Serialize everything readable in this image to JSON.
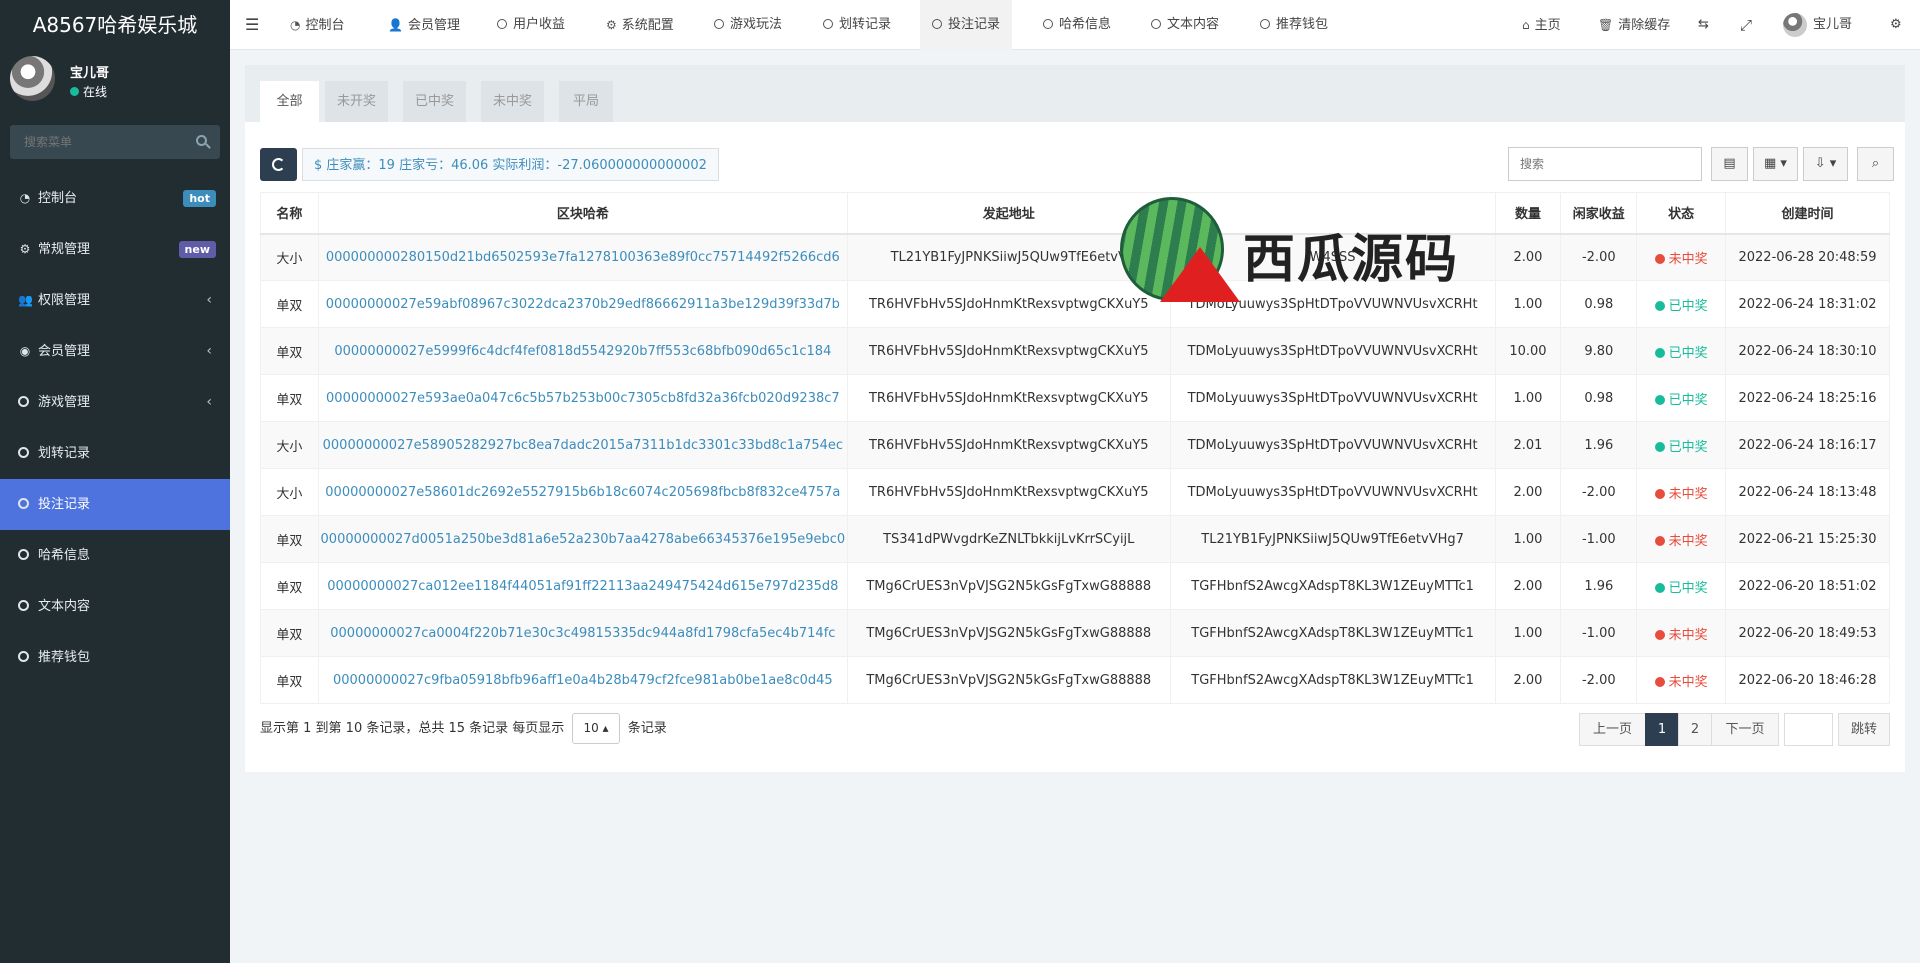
{
  "brand": "A8567哈希娱乐城",
  "user": {
    "name": "宝儿哥",
    "status": "在线"
  },
  "sidebar": {
    "search_placeholder": "搜索菜单",
    "items": [
      {
        "label": "控制台",
        "icon": "dashboard-icon",
        "badge": "hot"
      },
      {
        "label": "常规管理",
        "icon": "cogs-icon",
        "badge": "new"
      },
      {
        "label": "权限管理",
        "icon": "group-icon",
        "chevron": "‹"
      },
      {
        "label": "会员管理",
        "icon": "user-circle-icon",
        "chevron": "‹"
      },
      {
        "label": "游戏管理",
        "icon": "circle-icon",
        "chevron": "‹"
      },
      {
        "label": "划转记录",
        "icon": "circle-icon"
      },
      {
        "label": "投注记录",
        "icon": "circle-icon",
        "active": true
      },
      {
        "label": "哈希信息",
        "icon": "circle-icon"
      },
      {
        "label": "文本内容",
        "icon": "circle-icon"
      },
      {
        "label": "推荐钱包",
        "icon": "circle-icon"
      }
    ]
  },
  "topnav": {
    "tabs": [
      "控制台",
      "会员管理",
      "用户收益",
      "系统配置",
      "游戏玩法",
      "划转记录",
      "投注记录",
      "哈希信息",
      "文本内容",
      "推荐钱包"
    ],
    "home": "主页",
    "clear_cache": "清除缓存",
    "user": "宝儿哥"
  },
  "filters": [
    "全部",
    "未开奖",
    "已中奖",
    "未中奖",
    "平局"
  ],
  "summary": "$ 庄家赢：19 庄家亏：46.06 实际利润：-27.060000000000002",
  "search_placeholder": "搜索",
  "columns": [
    "名称",
    "区块哈希",
    "发起地址",
    "",
    "数量",
    "闲家收益",
    "状态",
    "创建时间"
  ],
  "rows": [
    {
      "name": "大小",
      "hash": "000000000280150d21bd6502593e7fa1278100363e89f0cc75714492f5266cd6",
      "from": "TL21YB1FyJPNKSiiwJ5QUw9TfE6etvV",
      "to": "W4SSS",
      "amount": "2.00",
      "profit": "-2.00",
      "status": "未中奖",
      "win": false,
      "time": "2022-06-28 20:48:59"
    },
    {
      "name": "单双",
      "hash": "00000000027e59abf08967c3022dca2370b29edf86662911a3be129d39f33d7b",
      "from": "TR6HVFbHv5SJdoHnmKtRexsvptwgCKXuY5",
      "to": "TDMoLyuuwys3SpHtDTpoVVUWNVUsvXCRHt",
      "amount": "1.00",
      "profit": "0.98",
      "status": "已中奖",
      "win": true,
      "time": "2022-06-24 18:31:02"
    },
    {
      "name": "单双",
      "hash": "00000000027e5999f6c4dcf4fef0818d5542920b7ff553c68bfb090d65c1c184",
      "from": "TR6HVFbHv5SJdoHnmKtRexsvptwgCKXuY5",
      "to": "TDMoLyuuwys3SpHtDTpoVVUWNVUsvXCRHt",
      "amount": "10.00",
      "profit": "9.80",
      "status": "已中奖",
      "win": true,
      "time": "2022-06-24 18:30:10"
    },
    {
      "name": "单双",
      "hash": "00000000027e593ae0a047c6c5b57b253b00c7305cb8fd32a36fcb020d9238c7",
      "from": "TR6HVFbHv5SJdoHnmKtRexsvptwgCKXuY5",
      "to": "TDMoLyuuwys3SpHtDTpoVVUWNVUsvXCRHt",
      "amount": "1.00",
      "profit": "0.98",
      "status": "已中奖",
      "win": true,
      "time": "2022-06-24 18:25:16"
    },
    {
      "name": "大小",
      "hash": "00000000027e58905282927bc8ea7dadc2015a7311b1dc3301c33bd8c1a754ec",
      "from": "TR6HVFbHv5SJdoHnmKtRexsvptwgCKXuY5",
      "to": "TDMoLyuuwys3SpHtDTpoVVUWNVUsvXCRHt",
      "amount": "2.01",
      "profit": "1.96",
      "status": "已中奖",
      "win": true,
      "time": "2022-06-24 18:16:17"
    },
    {
      "name": "大小",
      "hash": "00000000027e58601dc2692e5527915b6b18c6074c205698fbcb8f832ce4757a",
      "from": "TR6HVFbHv5SJdoHnmKtRexsvptwgCKXuY5",
      "to": "TDMoLyuuwys3SpHtDTpoVVUWNVUsvXCRHt",
      "amount": "2.00",
      "profit": "-2.00",
      "status": "未中奖",
      "win": false,
      "time": "2022-06-24 18:13:48"
    },
    {
      "name": "单双",
      "hash": "00000000027d0051a250be3d81a6e52a230b7aa4278abe66345376e195e9ebc0",
      "from": "TS341dPWvgdrKeZNLTbkkijLvKrrSCyijL",
      "to": "TL21YB1FyJPNKSiiwJ5QUw9TfE6etvVHg7",
      "amount": "1.00",
      "profit": "-1.00",
      "status": "未中奖",
      "win": false,
      "time": "2022-06-21 15:25:30"
    },
    {
      "name": "单双",
      "hash": "00000000027ca012ee1184f44051af91ff22113aa249475424d615e797d235d8",
      "from": "TMg6CrUES3nVpVJSG2N5kGsFgTxwG88888",
      "to": "TGFHbnfS2AwcgXAdspT8KL3W1ZEuyMTTc1",
      "amount": "2.00",
      "profit": "1.96",
      "status": "已中奖",
      "win": true,
      "time": "2022-06-20 18:51:02"
    },
    {
      "name": "单双",
      "hash": "00000000027ca0004f220b71e30c3c49815335dc944a8fd1798cfa5ec4b714fc",
      "from": "TMg6CrUES3nVpVJSG2N5kGsFgTxwG88888",
      "to": "TGFHbnfS2AwcgXAdspT8KL3W1ZEuyMTTc1",
      "amount": "1.00",
      "profit": "-1.00",
      "status": "未中奖",
      "win": false,
      "time": "2022-06-20 18:49:53"
    },
    {
      "name": "单双",
      "hash": "00000000027c9fba05918bfb96aff1e0a4b28b479cf2fce981ab0be1ae8c0d45",
      "from": "TMg6CrUES3nVpVJSG2N5kGsFgTxwG88888",
      "to": "TGFHbnfS2AwcgXAdspT8KL3W1ZEuyMTTc1",
      "amount": "2.00",
      "profit": "-2.00",
      "status": "未中奖",
      "win": false,
      "time": "2022-06-20 18:46:28"
    }
  ],
  "footer": {
    "text_before": "显示第 1 到第 10 条记录，总共 15 条记录 每页显示",
    "page_size": "10",
    "text_after": "条记录"
  },
  "pagination": {
    "prev": "上一页",
    "pages": [
      "1",
      "2"
    ],
    "next": "下一页",
    "jump": "跳转"
  },
  "watermark": "西瓜源码",
  "colors": {
    "sidebar_bg": "#222d32",
    "active_menu": "#4e73df",
    "link": "#3c8dbc",
    "win": "#18bc9c",
    "lose": "#e74c3c"
  }
}
